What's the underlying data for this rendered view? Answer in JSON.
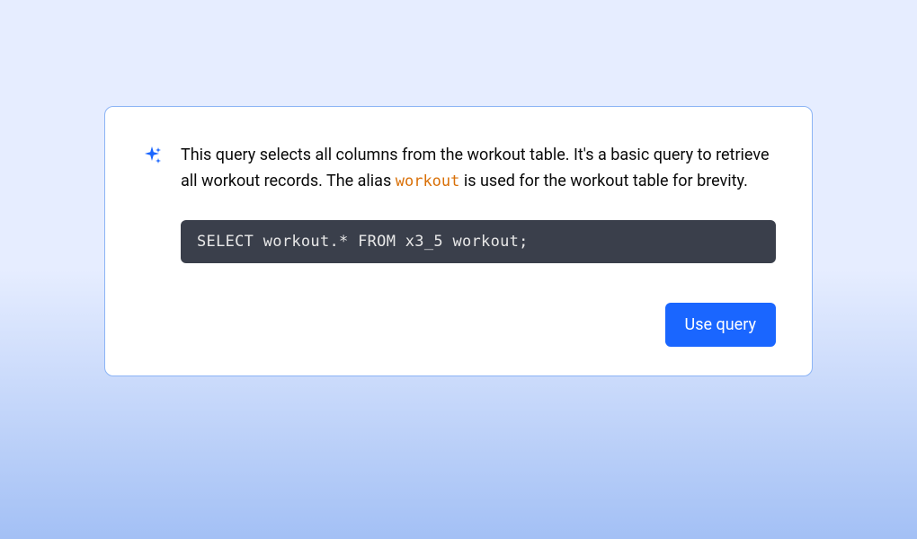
{
  "card": {
    "description_before_code": "This query selects all columns from the workout table. It's a basic query to retrieve all workout records. The alias ",
    "inline_code": "workout",
    "description_after_code": " is used for the workout table for brevity.",
    "sql_query": "SELECT workout.* FROM x3_5 workout;",
    "button_label": "Use query"
  }
}
